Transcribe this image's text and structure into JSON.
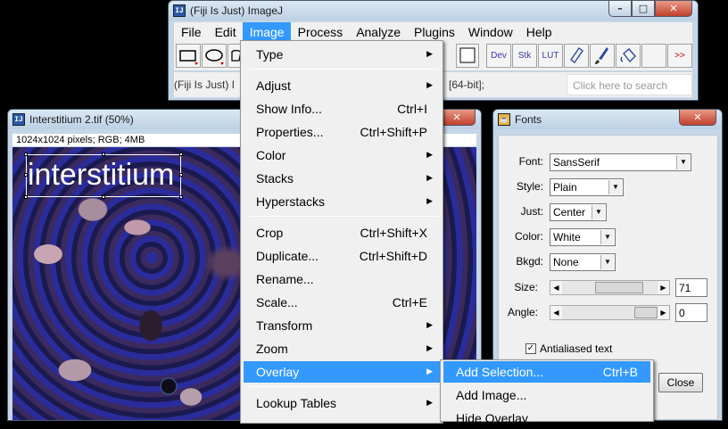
{
  "imagej_window": {
    "title": "(Fiji Is Just) ImageJ",
    "icon": "ij-icon",
    "menus": [
      "File",
      "Edit",
      "Image",
      "Process",
      "Analyze",
      "Plugins",
      "Window",
      "Help"
    ],
    "tools": [
      {
        "icon": "rectangle-tool-icon",
        "label": ""
      },
      {
        "icon": "oval-tool-icon",
        "label": ""
      },
      {
        "icon": "polygon-tool-icon",
        "label": ""
      },
      {
        "icon": "color-swatch-icon",
        "label": ""
      },
      {
        "icon": "dev-menu-icon",
        "label": "Dev"
      },
      {
        "icon": "stk-menu-icon",
        "label": "Stk"
      },
      {
        "icon": "lut-menu-icon",
        "label": "LUT"
      },
      {
        "icon": "pencil-tool-icon",
        "label": ""
      },
      {
        "icon": "brush-tool-icon",
        "label": ""
      },
      {
        "icon": "flood-fill-icon",
        "label": ""
      },
      {
        "icon": "more-tools-icon",
        "label": ">>"
      }
    ],
    "status_left": "(Fiji Is Just) I",
    "status_right": "[64-bit];",
    "search_placeholder": "Click here to search"
  },
  "image_window": {
    "title": "Interstitium 2.tif (50%)",
    "info": "1024x1024 pixels; RGB; 4MB",
    "overlay_text": "interstitium"
  },
  "fonts_window": {
    "title": "Fonts",
    "font_label": "Font:",
    "font_value": "SansSerif",
    "style_label": "Style:",
    "style_value": "Plain",
    "just_label": "Just:",
    "just_value": "Center",
    "color_label": "Color:",
    "color_value": "White",
    "bkgd_label": "Bkgd:",
    "bkgd_value": "None",
    "size_label": "Size:",
    "size_value": "71",
    "angle_label": "Angle:",
    "angle_value": "0",
    "antialiased_label": "Antialiased text",
    "antialiased_checked": true,
    "close_label": "Close"
  },
  "image_menu": {
    "items": [
      {
        "label": "Type",
        "shortcut": "",
        "submenu": true
      },
      {
        "label": "Adjust",
        "shortcut": "",
        "submenu": true
      },
      {
        "label": "Show Info...",
        "shortcut": "Ctrl+I",
        "submenu": false
      },
      {
        "label": "Properties...",
        "shortcut": "Ctrl+Shift+P",
        "submenu": false
      },
      {
        "label": "Color",
        "shortcut": "",
        "submenu": true
      },
      {
        "label": "Stacks",
        "shortcut": "",
        "submenu": true
      },
      {
        "label": "Hyperstacks",
        "shortcut": "",
        "submenu": true
      },
      {
        "label": "Crop",
        "shortcut": "Ctrl+Shift+X",
        "submenu": false
      },
      {
        "label": "Duplicate...",
        "shortcut": "Ctrl+Shift+D",
        "submenu": false
      },
      {
        "label": "Rename...",
        "shortcut": "",
        "submenu": false
      },
      {
        "label": "Scale...",
        "shortcut": "Ctrl+E",
        "submenu": false
      },
      {
        "label": "Transform",
        "shortcut": "",
        "submenu": true
      },
      {
        "label": "Zoom",
        "shortcut": "",
        "submenu": true
      },
      {
        "label": "Overlay",
        "shortcut": "",
        "submenu": true
      },
      {
        "label": "Lookup Tables",
        "shortcut": "",
        "submenu": true
      }
    ]
  },
  "overlay_menu": {
    "items": [
      {
        "label": "Add Selection...",
        "shortcut": "Ctrl+B"
      },
      {
        "label": "Add Image...",
        "shortcut": ""
      },
      {
        "label": "Hide Overlay",
        "shortcut": ""
      }
    ]
  },
  "colors": {
    "menu_highlight": "#3399ff",
    "window_frame": "#c5d6e6",
    "close_button": "#c0402c"
  }
}
